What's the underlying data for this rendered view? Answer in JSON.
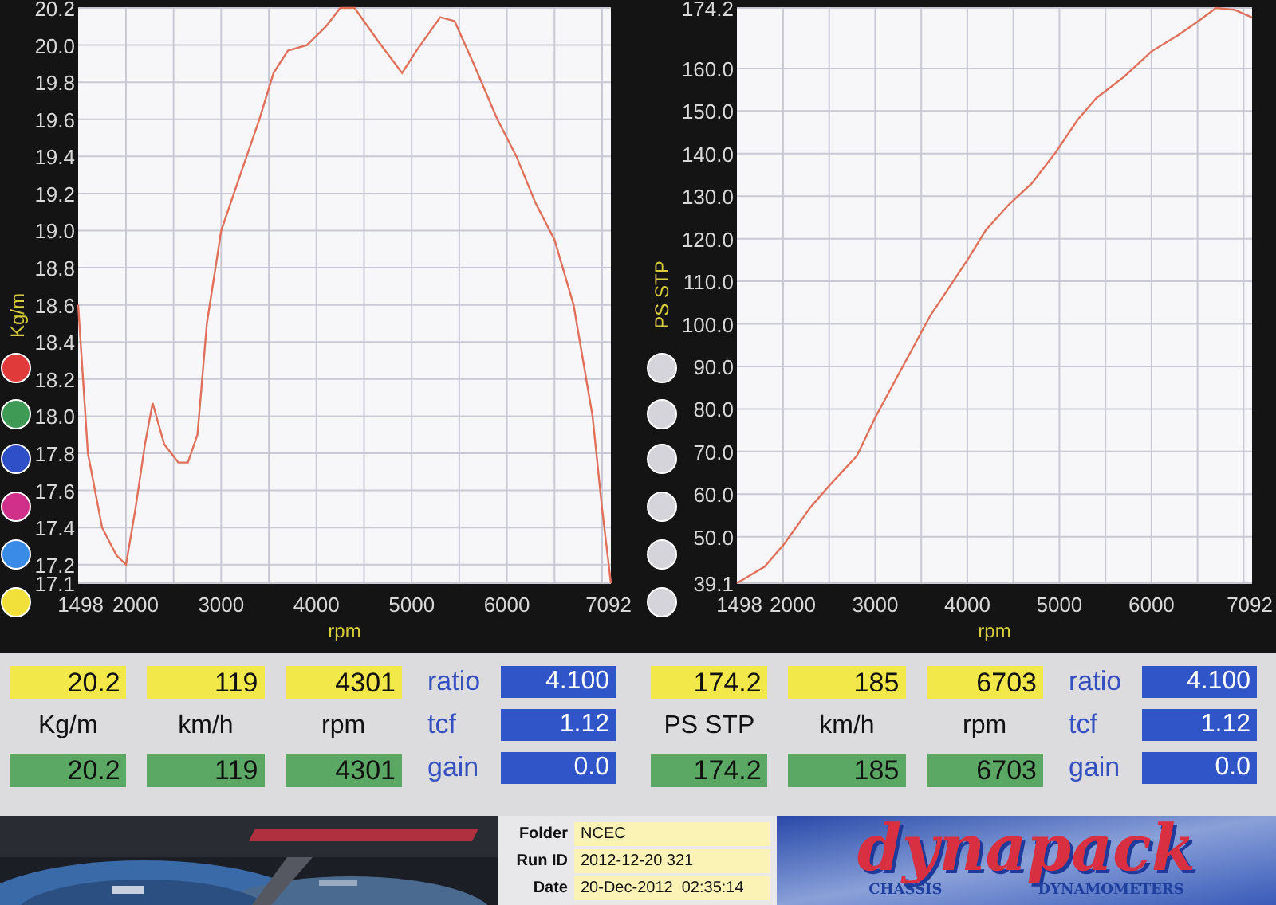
{
  "charts": [
    {
      "legend_dots": [
        {
          "color": "#e03a3a"
        },
        {
          "color": "#3f9a55"
        },
        {
          "color": "#2f4fc8"
        },
        {
          "color": "#d0308a"
        },
        {
          "color": "#3a8ae8"
        },
        {
          "color": "#f2e03a"
        }
      ],
      "chart_data": {
        "type": "line",
        "grid": true,
        "xlabel": "rpm",
        "ylabel": "Kg/m",
        "xlim": [
          1498,
          7092
        ],
        "ylim": [
          17.1,
          20.2
        ],
        "xticks": [
          1498,
          2000,
          3000,
          4000,
          5000,
          6000,
          7092
        ],
        "yticks": [
          {
            "value": 17.1,
            "label": "17.1"
          },
          {
            "value": 17.2,
            "label": "17.2"
          },
          {
            "value": 17.4,
            "label": "17.4"
          },
          {
            "value": 17.6,
            "label": "17.6"
          },
          {
            "value": 17.8,
            "label": "17.8"
          },
          {
            "value": 18.0,
            "label": "18.0"
          },
          {
            "value": 18.2,
            "label": "18.2"
          },
          {
            "value": 18.4,
            "label": "18.4"
          },
          {
            "value": 18.6,
            "label": "18.6"
          },
          {
            "value": 18.8,
            "label": "18.8"
          },
          {
            "value": 19.0,
            "label": "19.0"
          },
          {
            "value": 19.2,
            "label": "19.2"
          },
          {
            "value": 19.4,
            "label": "19.4"
          },
          {
            "value": 19.6,
            "label": "19.6"
          },
          {
            "value": 19.8,
            "label": "19.8"
          },
          {
            "value": 20.0,
            "label": "20.0"
          },
          {
            "value": 20.2,
            "label": "20.2"
          }
        ],
        "x": [
          1498,
          1600,
          1750,
          1900,
          2000,
          2100,
          2200,
          2280,
          2400,
          2550,
          2650,
          2750,
          2850,
          3000,
          3200,
          3400,
          3550,
          3700,
          3900,
          4100,
          4250,
          4400,
          4650,
          4900,
          5050,
          5300,
          5450,
          5650,
          5900,
          6100,
          6300,
          6500,
          6700,
          6900,
          7000,
          7092
        ],
        "series": [
          {
            "color": "#e0705a",
            "values": [
              18.6,
              17.8,
              17.4,
              17.25,
              17.2,
              17.5,
              17.85,
              18.07,
              17.85,
              17.75,
              17.75,
              17.9,
              18.5,
              19.0,
              19.3,
              19.6,
              19.85,
              19.97,
              20.0,
              20.1,
              20.2,
              20.2,
              20.02,
              19.85,
              19.97,
              20.15,
              20.13,
              19.9,
              19.6,
              19.4,
              19.15,
              18.95,
              18.6,
              18.0,
              17.5,
              17.1
            ]
          }
        ]
      }
    },
    {
      "legend_dots": [
        {
          "color": "#d4d4da"
        },
        {
          "color": "#d4d4da"
        },
        {
          "color": "#d4d4da"
        },
        {
          "color": "#d4d4da"
        },
        {
          "color": "#d4d4da"
        },
        {
          "color": "#d4d4da"
        }
      ],
      "chart_data": {
        "type": "line",
        "grid": true,
        "xlabel": "rpm",
        "ylabel": "PS STP",
        "xlim": [
          1498,
          7092
        ],
        "ylim": [
          39.1,
          174.2
        ],
        "xticks": [
          1498,
          2000,
          3000,
          4000,
          5000,
          6000,
          7092
        ],
        "yticks": [
          {
            "value": 39.1,
            "label": "39.1"
          },
          {
            "value": 50,
            "label": "50.0"
          },
          {
            "value": 60,
            "label": "60.0"
          },
          {
            "value": 70,
            "label": "70.0"
          },
          {
            "value": 80,
            "label": "80.0"
          },
          {
            "value": 90,
            "label": "90.0"
          },
          {
            "value": 100,
            "label": "100.0"
          },
          {
            "value": 110,
            "label": "110.0"
          },
          {
            "value": 120,
            "label": "120.0"
          },
          {
            "value": 130,
            "label": "130.0"
          },
          {
            "value": 140,
            "label": "140.0"
          },
          {
            "value": 150,
            "label": "150.0"
          },
          {
            "value": 160,
            "label": "160.0"
          },
          {
            "value": 174.2,
            "label": "174.2"
          }
        ],
        "x": [
          1498,
          1800,
          2000,
          2300,
          2500,
          2800,
          3000,
          3300,
          3600,
          4000,
          4200,
          4450,
          4700,
          4950,
          5200,
          5400,
          5700,
          6000,
          6300,
          6500,
          6700,
          6900,
          7092
        ],
        "series": [
          {
            "color": "#e0705a",
            "values": [
              39.1,
              43,
              48,
              57,
              62,
              69,
              78,
              90,
              102,
              115,
              122,
              128,
              133,
              140,
              148,
              153,
              158,
              164,
              168,
              171,
              174.2,
              173.8,
              172
            ]
          }
        ]
      }
    }
  ],
  "panels": [
    {
      "readouts": [
        {
          "peak": "20.2",
          "unit": "Kg/m",
          "current": "20.2"
        },
        {
          "peak": "119",
          "unit": "km/h",
          "current": "119"
        },
        {
          "peak": "4301",
          "unit": "rpm",
          "current": "4301"
        }
      ],
      "settings": [
        {
          "label": "ratio",
          "value": "4.100"
        },
        {
          "label": "tcf",
          "value": "1.12"
        },
        {
          "label": "gain",
          "value": "0.0"
        }
      ]
    },
    {
      "readouts": [
        {
          "peak": "174.2",
          "unit": "PS STP",
          "current": "174.2"
        },
        {
          "peak": "185",
          "unit": "km/h",
          "current": "185"
        },
        {
          "peak": "6703",
          "unit": "rpm",
          "current": "6703"
        }
      ],
      "settings": [
        {
          "label": "ratio",
          "value": "4.100"
        },
        {
          "label": "tcf",
          "value": "1.12"
        },
        {
          "label": "gain",
          "value": "0.0"
        }
      ]
    }
  ],
  "run_info": [
    {
      "label": "Folder",
      "value": "NCEC"
    },
    {
      "label": "Run ID",
      "value": "2012-12-20 321"
    },
    {
      "label": "Date",
      "value": "20-Dec-2012  02:35:14"
    }
  ],
  "logo": {
    "name": "dynapack",
    "left_word": "CHASSIS",
    "right_word": "DYNAMOMETERS"
  }
}
